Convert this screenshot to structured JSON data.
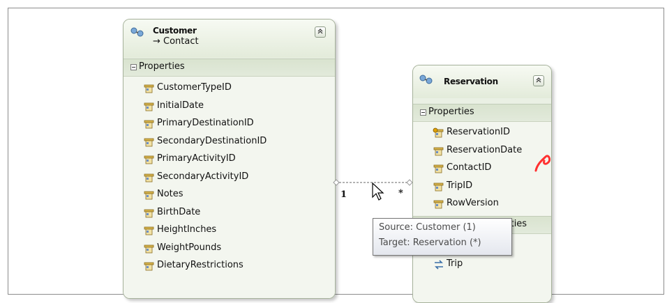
{
  "customer": {
    "title": "Customer",
    "subtitle": "→ Contact",
    "section_label": "Properties",
    "properties": [
      "CustomerTypeID",
      "InitialDate",
      "PrimaryDestinationID",
      "SecondaryDestinationID",
      "PrimaryActivityID",
      "SecondaryActivityID",
      "Notes",
      "BirthDate",
      "HeightInches",
      "WeightPounds",
      "DietaryRestrictions"
    ]
  },
  "reservation": {
    "title": "Reservation",
    "section_label": "Properties",
    "properties": [
      {
        "name": "ReservationID",
        "key": true
      },
      {
        "name": "ReservationDate",
        "key": false
      },
      {
        "name": "ContactID",
        "key": false
      },
      {
        "name": "TripID",
        "key": false
      },
      {
        "name": "RowVersion",
        "key": false
      }
    ],
    "nav_section_label_partial": "perties",
    "nav_items": [
      "Trip"
    ]
  },
  "association": {
    "source_multiplicity": "1",
    "target_multiplicity": "*"
  },
  "tooltip": {
    "source": "Source: Customer (1)",
    "target": "Target: Reservation (*)"
  },
  "colors": {
    "entity_bg": "#eef3e8",
    "entity_border": "#a6b29b",
    "section_bg": "#d9e3cf",
    "watermark": "#ff2020"
  }
}
